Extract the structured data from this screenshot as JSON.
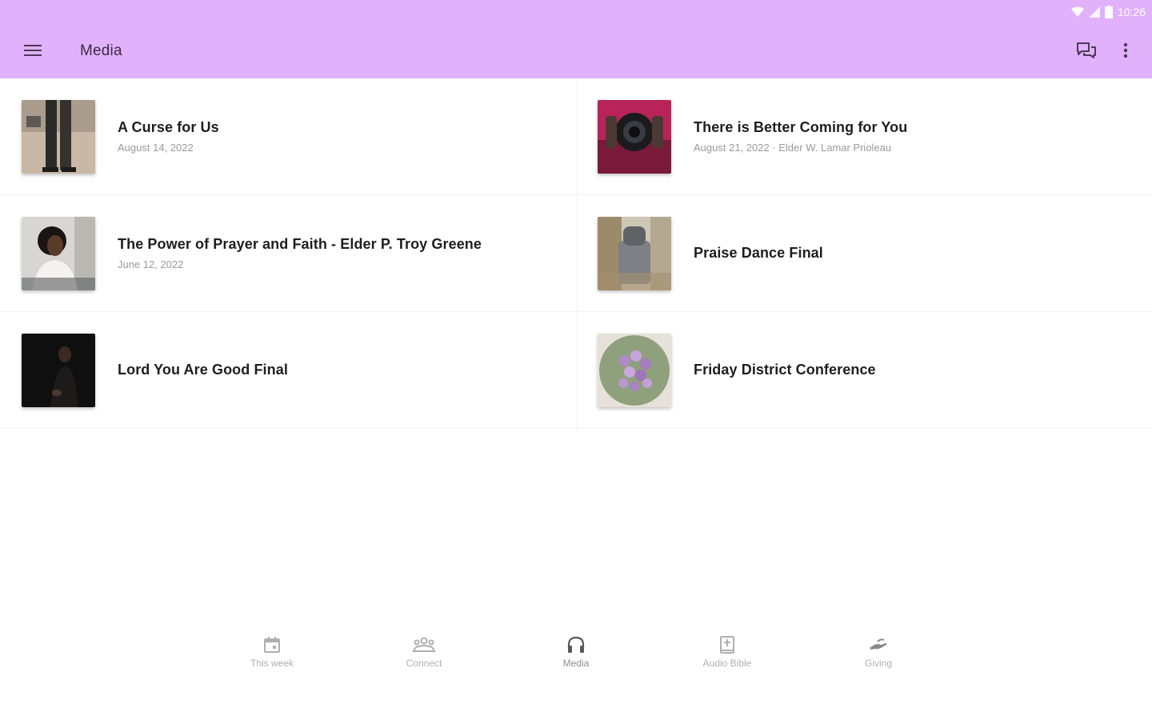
{
  "status": {
    "time": "10:26"
  },
  "appbar": {
    "title": "Media",
    "menu_icon": "hamburger-menu-icon",
    "chat_icon": "chat-icon",
    "more_icon": "more-vert-icon"
  },
  "items": [
    {
      "title": "A Curse for Us",
      "subtitle": "August 14, 2022"
    },
    {
      "title": "There is Better Coming for You",
      "subtitle": "August 21, 2022 · Elder W. Lamar Prioleau"
    },
    {
      "title": "The Power of Prayer and Faith - Elder P. Troy Greene",
      "subtitle": "June 12, 2022"
    },
    {
      "title": "Praise Dance Final",
      "subtitle": ""
    },
    {
      "title": "Lord You Are Good Final",
      "subtitle": ""
    },
    {
      "title": "Friday District Conference",
      "subtitle": ""
    }
  ],
  "bottom_nav": [
    {
      "label": "This week",
      "icon": "calendar-icon"
    },
    {
      "label": "Connect",
      "icon": "people-icon"
    },
    {
      "label": "Media",
      "icon": "headphones-icon",
      "active": true
    },
    {
      "label": "Audio Bible",
      "icon": "bible-icon"
    },
    {
      "label": "Giving",
      "icon": "giving-hand-icon"
    }
  ],
  "colors": {
    "appbar": "#e2b1fc",
    "title_text": "#3b2a46",
    "nav_inactive": "#b0b0b0"
  }
}
